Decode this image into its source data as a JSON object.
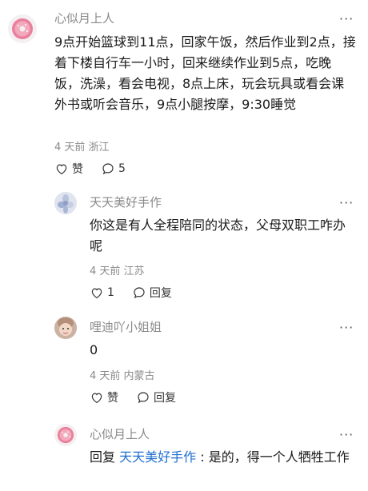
{
  "comments": [
    {
      "username": "心似月上人",
      "more": "···",
      "text": "9点开始篮球到11点，回家午饭，然后作业到2点，接着下楼自行车一小时，回来继续作业到5点，吃晚饭，洗澡，看会电视，8点上床，玩会玩具或看会课外书或听会音乐，9点小腿按摩，9:30睡觉",
      "meta": "4 天前 浙江",
      "like_label": "赞",
      "reply_label": "5"
    },
    {
      "username": "天天美好手作",
      "more": "···",
      "text": "你这是有人全程陪同的状态，父母双职工咋办呢",
      "meta": "4 天前 江苏",
      "like_label": "1",
      "reply_label": "回复"
    },
    {
      "username": "哩迪吖小姐姐",
      "more": "···",
      "text": "0",
      "meta": "4 天前 内蒙古",
      "like_label": "赞",
      "reply_label": "回复"
    },
    {
      "username": "心似月上人",
      "more": "···",
      "reply_prefix": "回复",
      "reply_to": "天天美好手作",
      "reply_sep": ":",
      "text": "是的，得一个人牺牲工作"
    }
  ]
}
